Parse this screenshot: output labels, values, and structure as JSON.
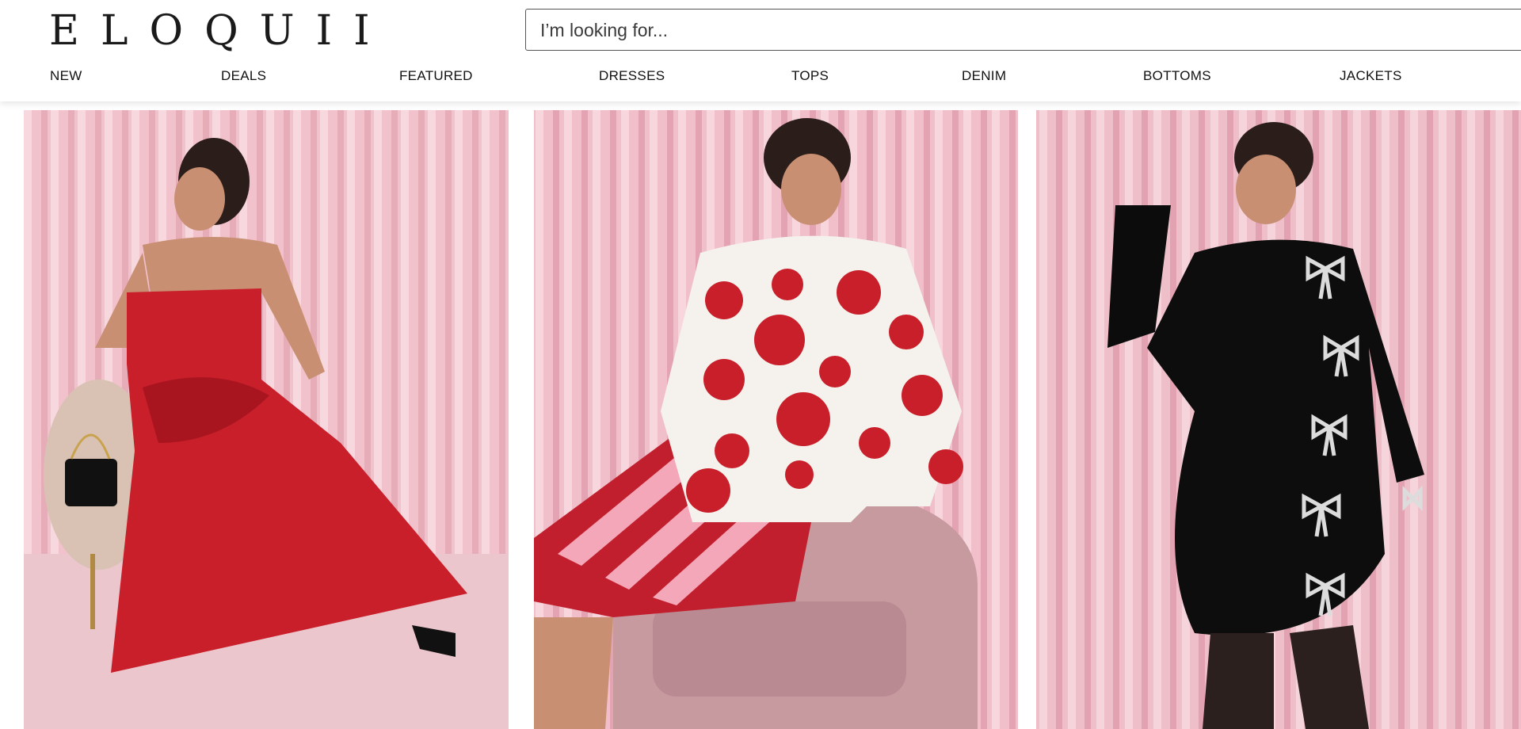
{
  "header": {
    "logo": "ELOQUII",
    "search": {
      "placeholder": "I’m looking for...",
      "value": ""
    },
    "search_icon": "search-icon"
  },
  "nav": {
    "items": [
      "NEW",
      "DEALS",
      "FEATURED",
      "DRESSES",
      "TOPS",
      "DENIM",
      "BOTTOMS",
      "JACKETS"
    ]
  },
  "products": [
    {
      "image": "model-in-red-strapless-dress",
      "accent": "#c8222b"
    },
    {
      "image": "model-in-poppy-sweater-and-striped-skirt",
      "accent": "#b31a26"
    },
    {
      "image": "model-in-black-bow-embellished-dress",
      "accent": "#111111"
    }
  ],
  "colors": {
    "curtain": "#f2c3cc",
    "curtain_dark": "#e7a9b6",
    "text": "#111111"
  }
}
